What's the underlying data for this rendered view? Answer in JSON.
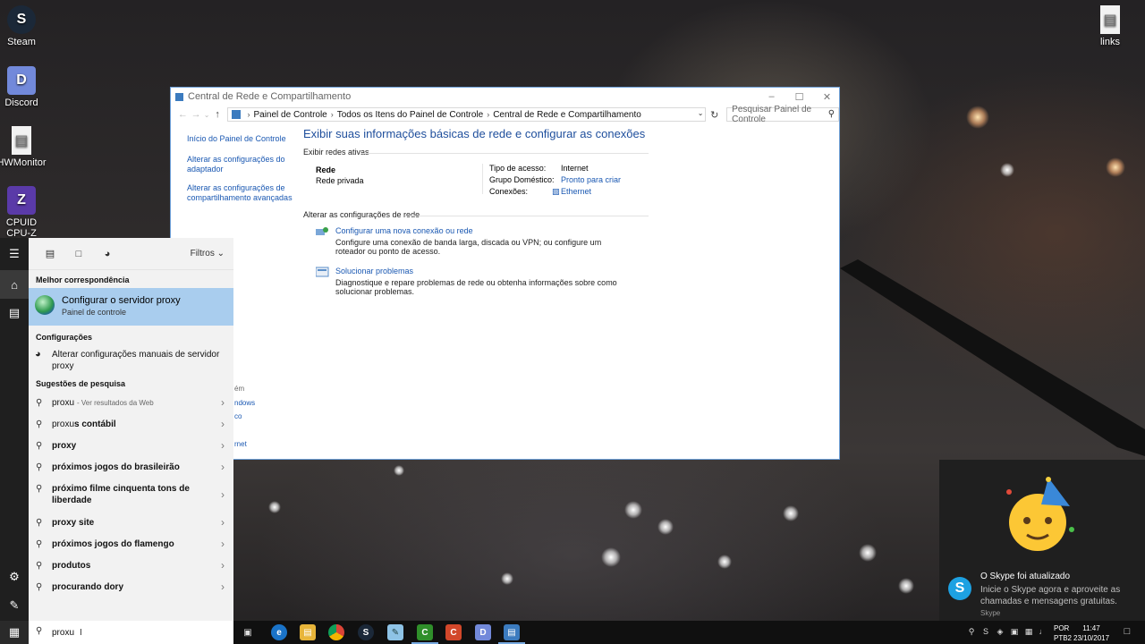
{
  "desktop": {
    "icons": [
      "Steam",
      "Discord",
      "HWMonitor",
      "CPUID CPU-Z",
      "links"
    ]
  },
  "window": {
    "title": "Central de Rede e Compartilhamento",
    "breadcrumb": [
      "Painel de Controle",
      "Todos os Itens do Painel de Controle",
      "Central de Rede e Compartilhamento"
    ],
    "search_placeholder": "Pesquisar Painel de Controle",
    "left_links": {
      "home": "Início do Painel de Controle",
      "adapter": "Alterar as configurações do adaptador",
      "sharing": "Alterar as configurações de compartilhamento avançadas"
    },
    "heading": "Exibir suas informações básicas de rede e configurar as conexões",
    "active_networks_label": "Exibir redes ativas",
    "network": {
      "name": "Rede",
      "type": "Rede privada",
      "access_label": "Tipo de acesso:",
      "access_value": "Internet",
      "homegroup_label": "Grupo Doméstico:",
      "homegroup_value": "Pronto para criar",
      "connections_label": "Conexões:",
      "connections_value": "Ethernet"
    },
    "change_settings_label": "Alterar as configurações de rede",
    "tasks": [
      {
        "link": "Configurar uma nova conexão ou rede",
        "desc": "Configure uma conexão de banda larga, discada ou VPN; ou configure um roteador ou ponto de acesso."
      },
      {
        "link": "Solucionar problemas",
        "desc": "Diagnostique e repare problemas de rede ou obtenha informações sobre como solucionar problemas."
      }
    ],
    "hidden_fragments": [
      "ém",
      "ndows",
      "co",
      "rnet"
    ]
  },
  "search": {
    "filters_label": "Filtros",
    "best_match_label": "Melhor correspondência",
    "best_match": {
      "title": "Configurar o servidor proxy",
      "subtitle": "Painel de controle"
    },
    "settings_label": "Configurações",
    "setting_item": "Alterar configurações manuais de servidor proxy",
    "suggestions_label": "Sugestões de pesquisa",
    "suggestions": [
      {
        "prefix": "proxu",
        "bold": "",
        "hint": "- Ver resultados da Web"
      },
      {
        "prefix": "proxu",
        "bold": "s contábil",
        "hint": ""
      },
      {
        "prefix": "",
        "bold": "proxy",
        "hint": ""
      },
      {
        "prefix": "",
        "bold": "próximos jogos do brasileirão",
        "hint": ""
      },
      {
        "prefix": "",
        "bold": "próximo filme cinquenta tons de liberdade",
        "hint": ""
      },
      {
        "prefix": "",
        "bold": "proxy site",
        "hint": ""
      },
      {
        "prefix": "",
        "bold": "próximos jogos do flamengo",
        "hint": ""
      },
      {
        "prefix": "",
        "bold": "produtos",
        "hint": ""
      },
      {
        "prefix": "",
        "bold": "procurando dory",
        "hint": ""
      }
    ],
    "query": "proxu"
  },
  "taskbar": {
    "language": "POR",
    "layout": "PTB2",
    "time": "11:47",
    "date": "23/10/2017"
  },
  "toast": {
    "title": "O Skype foi atualizado",
    "body": "Inicie o Skype agora e aproveite as chamadas e mensagens gratuitas.",
    "source": "Skype"
  }
}
